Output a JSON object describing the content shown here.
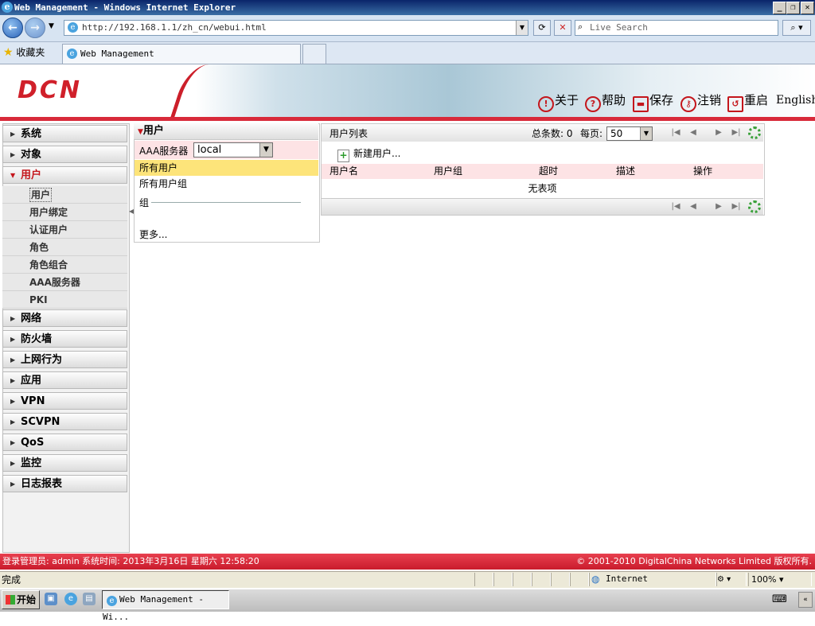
{
  "browser": {
    "window_title": "Web Management - Windows Internet Explorer",
    "url": "http://192.168.1.1/zh_cn/webui.html",
    "search_placeholder": "Live Search",
    "favorites_label": "收藏夹",
    "tab_title": "Web Management",
    "status_text": "完成",
    "zone_text": "Internet",
    "zoom_text": "100%"
  },
  "header": {
    "logo": "DCN",
    "nav": [
      {
        "icon": "info-icon",
        "label": "关于"
      },
      {
        "icon": "help-icon",
        "label": "帮助"
      },
      {
        "icon": "save-icon",
        "label": "保存"
      },
      {
        "icon": "key-icon",
        "label": "注销"
      },
      {
        "icon": "restart-icon",
        "label": "重启"
      }
    ],
    "language": "English"
  },
  "sidebar": {
    "groups_top": [
      "系统",
      "对象"
    ],
    "open_group": "用户",
    "subitems": [
      "用户",
      "用户绑定",
      "认证用户",
      "角色",
      "角色组合",
      "AAA服务器",
      "PKI"
    ],
    "selected_subitem": "用户",
    "groups_bottom": [
      "网络",
      "防火墙",
      "上网行为",
      "应用",
      "VPN",
      "SCVPN",
      "QoS",
      "监控",
      "日志报表"
    ]
  },
  "user_panel": {
    "title": "用户",
    "aaa_label": "AAA服务器",
    "aaa_value": "local",
    "items": [
      "所有用户",
      "所有用户组"
    ],
    "group_label": "组",
    "more": "更多..."
  },
  "user_list": {
    "title": "用户列表",
    "total_label": "总条数: 0",
    "per_page_label": "每页:",
    "per_page_value": "50",
    "new_user": "新建用户...",
    "columns": [
      "用户名",
      "用户组",
      "超时",
      "描述",
      "操作"
    ],
    "empty_text": "无表项"
  },
  "footer": {
    "login_info": "登录管理员: admin 系统时间: 2013年3月16日 星期六 12:58:20",
    "copyright": "© 2001-2010 DigitalChina Networks Limited 版权所有."
  },
  "taskbar": {
    "start": "开始",
    "item": "Web Management - Wi..."
  }
}
